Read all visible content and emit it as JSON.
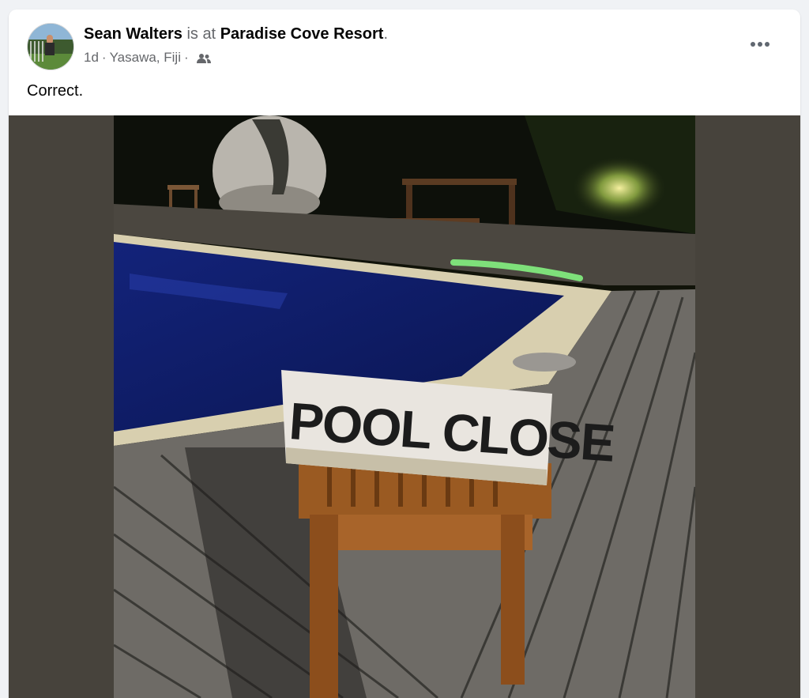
{
  "post": {
    "author": "Sean Walters",
    "is_at": "is at",
    "place": "Paradise Cove Resort",
    "period": ".",
    "time": "1d",
    "sep1": "·",
    "location": "Yasawa, Fiji",
    "sep2": "·",
    "audience_icon": "friends-icon",
    "more_icon": "more-horizontal-icon",
    "caption": "Correct."
  },
  "photo": {
    "sign_text": "POOL CLOSE"
  }
}
